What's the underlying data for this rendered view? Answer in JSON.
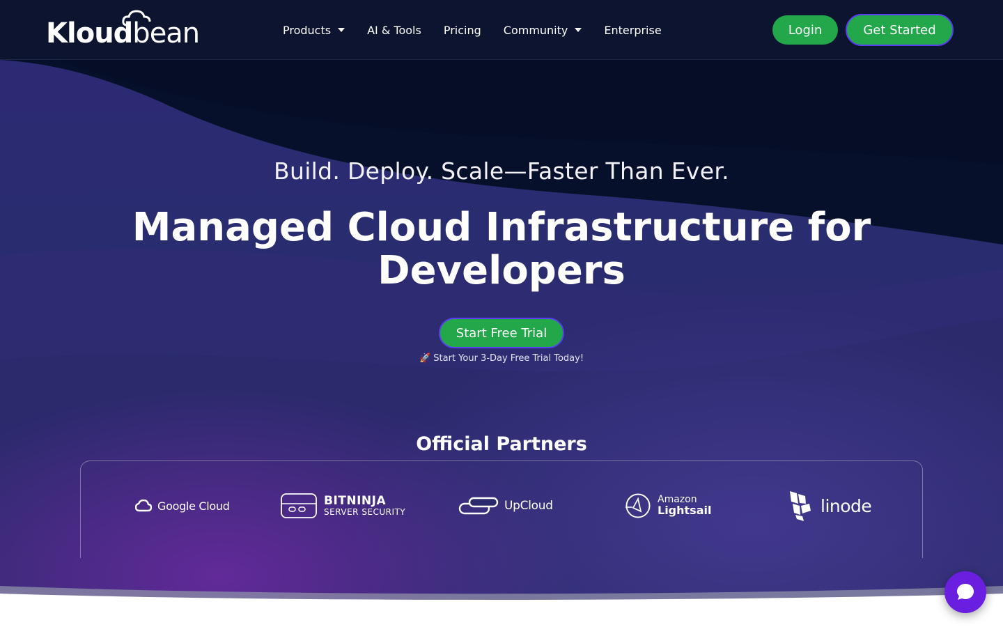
{
  "header": {
    "logo_text_bold": "Kloud",
    "logo_text_light": "bean",
    "nav": [
      {
        "label": "Products",
        "dropdown": true
      },
      {
        "label": "AI & Tools",
        "dropdown": false
      },
      {
        "label": "Pricing",
        "dropdown": false
      },
      {
        "label": "Community",
        "dropdown": true
      },
      {
        "label": "Enterprise",
        "dropdown": false
      }
    ],
    "login_label": "Login",
    "get_started_label": "Get Started"
  },
  "hero": {
    "tagline": "Build. Deploy. Scale—Faster Than Ever.",
    "headline_line1": "Managed Cloud Infrastructure for",
    "headline_line2": "Developers",
    "cta_label": "Start Free Trial",
    "trial_note": "🚀 Start Your 3-Day Free Trial Today!"
  },
  "partners": {
    "title": "Official Partners",
    "items": [
      {
        "name": "Google Cloud",
        "icon": "google-cloud-icon"
      },
      {
        "name": "BITNINJA",
        "sub": "SERVER SECURITY",
        "icon": "bitninja-icon"
      },
      {
        "name": "UpCloud",
        "icon": "upcloud-icon"
      },
      {
        "name": "Amazon",
        "sub": "Lightsail",
        "icon": "lightsail-icon"
      },
      {
        "name": "linode",
        "icon": "linode-icon"
      }
    ]
  },
  "colors": {
    "header_bg": "#0c1430",
    "accent_green": "#22a84a",
    "accent_purple": "#5b3df0",
    "chat_purple": "#6a1fe0"
  },
  "chat": {
    "icon": "chat-bubble-icon"
  }
}
